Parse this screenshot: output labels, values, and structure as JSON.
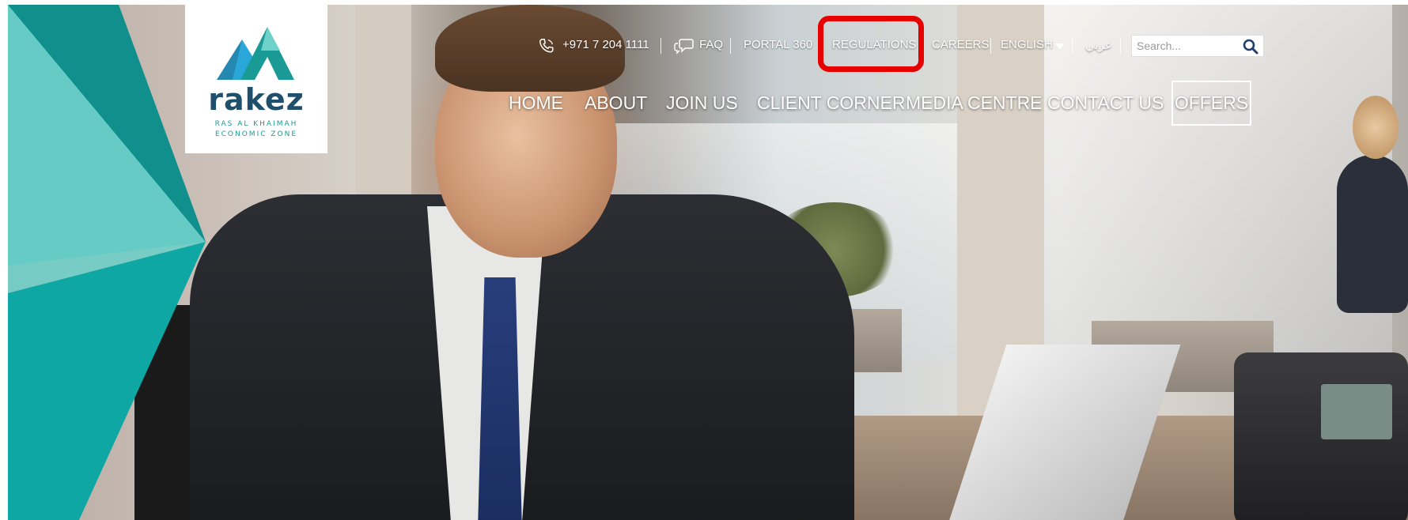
{
  "brand": {
    "name": "rakez",
    "subtitle_line1": "RAS AL KHAIMAH",
    "subtitle_line2": "ECONOMIC ZONE",
    "primary_color": "#1f4f6a",
    "accent_color": "#1a9a95"
  },
  "utility_bar": {
    "phone_icon": "phone-icon",
    "phone": "+971 7 204 1111",
    "faq_icon": "chat-bubble-icon",
    "faq": "FAQ",
    "portal": "PORTAL 360",
    "regulations": "REGULATIONS",
    "careers": "CAREERS",
    "language": "ENGLISH",
    "language_icon": "caret-down-icon",
    "arabic": "عربي",
    "search_placeholder": "Search...",
    "search_icon": "search-icon"
  },
  "main_nav": {
    "items": [
      "HOME",
      "ABOUT",
      "JOIN US",
      "CLIENT CORNER",
      "MEDIA CENTRE",
      "CONTACT US"
    ],
    "cta": "OFFERS"
  },
  "annotation": {
    "highlight_color": "#e60000",
    "highlighted_item": "REGULATIONS"
  }
}
